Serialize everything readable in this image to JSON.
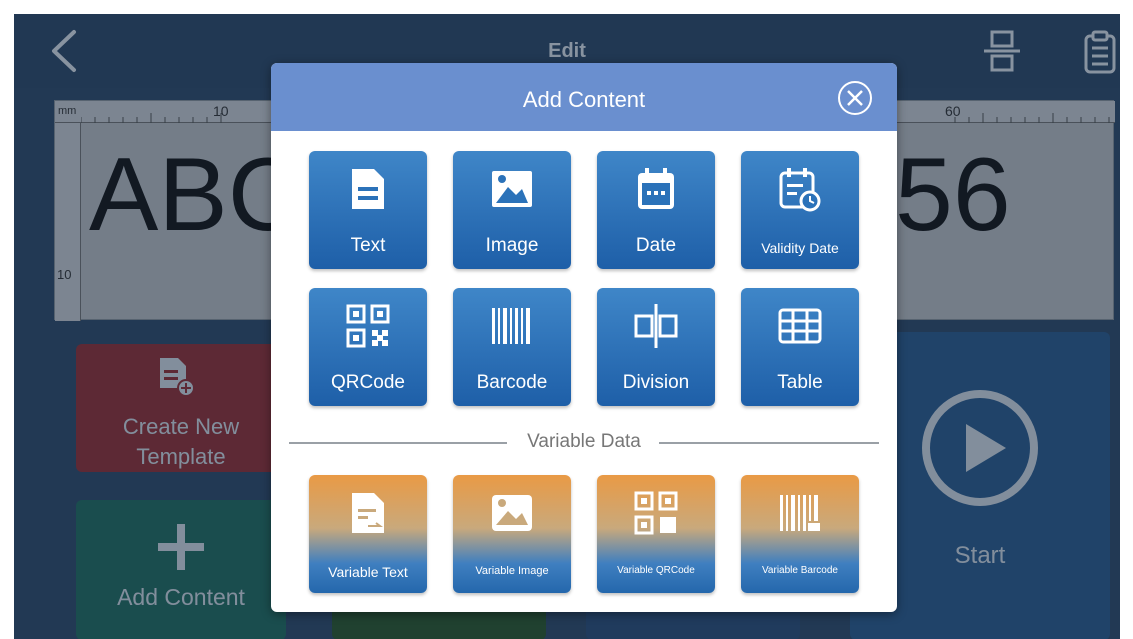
{
  "header": {
    "title": "Edit"
  },
  "canvas": {
    "unit": "mm",
    "tick_10": "10",
    "tick_60": "60",
    "left_tick_10": "10",
    "text_left": "ABC",
    "text_right": "56"
  },
  "tiles": {
    "create_template": "Create New Template",
    "add_content": "Add Content",
    "start": "Start"
  },
  "modal": {
    "title": "Add Content",
    "items": [
      {
        "label": "Text",
        "icon": "text-file-icon"
      },
      {
        "label": "Image",
        "icon": "image-icon"
      },
      {
        "label": "Date",
        "icon": "calendar-icon"
      },
      {
        "label": "Validity Date",
        "icon": "calendar-clock-icon"
      },
      {
        "label": "QRCode",
        "icon": "qrcode-icon"
      },
      {
        "label": "Barcode",
        "icon": "barcode-icon"
      },
      {
        "label": "Division",
        "icon": "division-icon"
      },
      {
        "label": "Table",
        "icon": "table-icon"
      }
    ],
    "divider": "Variable Data",
    "variable_items": [
      {
        "label": "Variable Text",
        "icon": "variable-text-icon"
      },
      {
        "label": "Variable Image",
        "icon": "variable-image-icon"
      },
      {
        "label": "Variable QRCode",
        "icon": "variable-qrcode-icon"
      },
      {
        "label": "Variable Barcode",
        "icon": "variable-barcode-icon"
      }
    ]
  },
  "colors": {
    "header_bg": "#2d4a6b",
    "modal_header": "#6a8fcf",
    "tile_blue": "#2b72b9",
    "tile_orange": "#e99a45",
    "create_tile": "#9a2e33",
    "add_tile": "#1f6f62",
    "start_tile": "#2a5d93"
  }
}
